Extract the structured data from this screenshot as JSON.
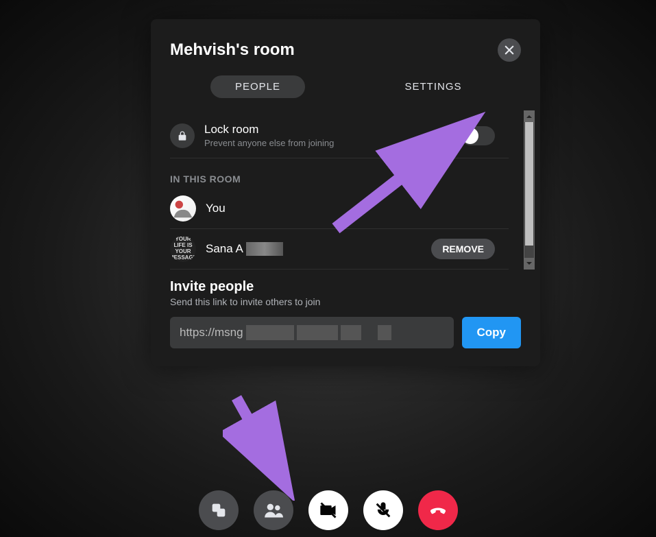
{
  "dialog": {
    "title": "Mehvish's room",
    "tabs": {
      "people": "PEOPLE",
      "settings": "SETTINGS"
    },
    "lock": {
      "title": "Lock room",
      "subtitle": "Prevent anyone else from joining"
    },
    "section_label": "IN THIS ROOM",
    "participants": [
      {
        "name": "You",
        "removable": false
      },
      {
        "name": "Sana A",
        "removable": true
      }
    ],
    "remove_label": "REMOVE",
    "invite": {
      "title": "Invite people",
      "subtitle": "Send this link to invite others to join",
      "link_prefix": "https://msng",
      "copy_label": "Copy"
    }
  },
  "colors": {
    "accent_blue": "#2196f3",
    "end_call_red": "#f02849"
  }
}
